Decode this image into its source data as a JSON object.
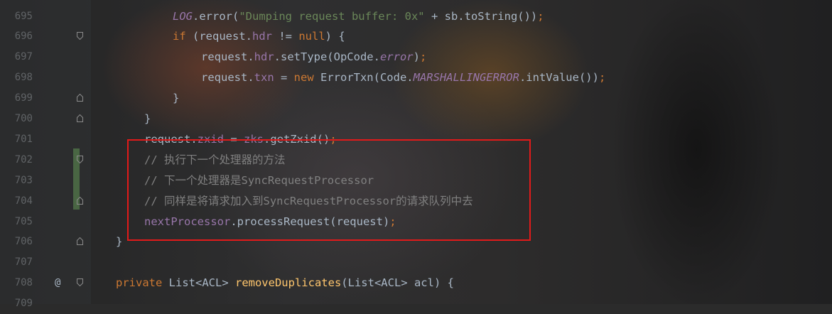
{
  "editor": {
    "lines": [
      {
        "num": "695",
        "indent": 243,
        "parts": [
          {
            "t": "LOG",
            "c": "fldi"
          },
          {
            "t": ".error(",
            "c": ""
          },
          {
            "t": "\"Dumping request buffer: 0x\"",
            "c": "str"
          },
          {
            "t": " + sb.toString())",
            "c": ""
          },
          {
            "t": ";",
            "c": "punc"
          }
        ]
      },
      {
        "num": "696",
        "indent": 243,
        "fold": "open",
        "parts": [
          {
            "t": "if",
            "c": "kw"
          },
          {
            "t": " (request.",
            "c": ""
          },
          {
            "t": "hdr",
            "c": "fld"
          },
          {
            "t": " != ",
            "c": ""
          },
          {
            "t": "null",
            "c": "kw"
          },
          {
            "t": ") {",
            "c": ""
          }
        ]
      },
      {
        "num": "697",
        "indent": 283,
        "parts": [
          {
            "t": "request.",
            "c": ""
          },
          {
            "t": "hdr",
            "c": "fld"
          },
          {
            "t": ".setType(OpCode.",
            "c": ""
          },
          {
            "t": "error",
            "c": "fldi"
          },
          {
            "t": ")",
            "c": ""
          },
          {
            "t": ";",
            "c": "punc"
          }
        ]
      },
      {
        "num": "698",
        "indent": 283,
        "parts": [
          {
            "t": "request.",
            "c": ""
          },
          {
            "t": "txn",
            "c": "fld"
          },
          {
            "t": " = ",
            "c": ""
          },
          {
            "t": "new",
            "c": "kw"
          },
          {
            "t": " ErrorTxn(Code.",
            "c": ""
          },
          {
            "t": "MARSHALLINGERROR",
            "c": "fldi"
          },
          {
            "t": ".intValue())",
            "c": ""
          },
          {
            "t": ";",
            "c": "punc"
          }
        ]
      },
      {
        "num": "699",
        "indent": 243,
        "fold": "close",
        "parts": [
          {
            "t": "}",
            "c": ""
          }
        ]
      },
      {
        "num": "700",
        "indent": 203,
        "fold": "close",
        "parts": [
          {
            "t": "}",
            "c": ""
          }
        ]
      },
      {
        "num": "701",
        "indent": 203,
        "parts": [
          {
            "t": "request.",
            "c": ""
          },
          {
            "t": "zxid",
            "c": "fld"
          },
          {
            "t": " = ",
            "c": ""
          },
          {
            "t": "zks",
            "c": "fld"
          },
          {
            "t": ".getZxid()",
            "c": ""
          },
          {
            "t": ";",
            "c": "punc"
          }
        ]
      },
      {
        "num": "702",
        "indent": 203,
        "fold": "open",
        "parts": [
          {
            "t": "// 执行下一个处理器的方法",
            "c": "cm"
          }
        ]
      },
      {
        "num": "703",
        "indent": 203,
        "parts": [
          {
            "t": "// 下一个处理器是SyncRequestProcessor",
            "c": "cm"
          }
        ]
      },
      {
        "num": "704",
        "indent": 203,
        "fold": "close",
        "parts": [
          {
            "t": "// 同样是将请求加入到SyncRequestProcessor的请求队列中去",
            "c": "cm"
          }
        ]
      },
      {
        "num": "705",
        "indent": 203,
        "parts": [
          {
            "t": "nextProcessor",
            "c": "fld"
          },
          {
            "t": ".processRequest(request)",
            "c": ""
          },
          {
            "t": ";",
            "c": "punc"
          }
        ]
      },
      {
        "num": "706",
        "indent": 163,
        "fold": "close",
        "parts": [
          {
            "t": "}",
            "c": ""
          }
        ]
      },
      {
        "num": "707",
        "indent": 163,
        "parts": []
      },
      {
        "num": "708",
        "indent": 163,
        "fold": "open",
        "annotation": "@",
        "parts": [
          {
            "t": "private",
            "c": "kw"
          },
          {
            "t": " List<ACL> ",
            "c": ""
          },
          {
            "t": "removeDuplicates",
            "c": "fn"
          },
          {
            "t": "(List<ACL> acl) {",
            "c": ""
          }
        ]
      },
      {
        "num": "709",
        "indent": 163,
        "parts": []
      }
    ]
  },
  "colors": {
    "highlight_border": "#e21a1a",
    "keyword": "#cc7832",
    "field": "#9876aa",
    "string": "#6a8759",
    "method_decl": "#ffc66d",
    "comment": "#808080",
    "text": "#a9b7c6"
  }
}
